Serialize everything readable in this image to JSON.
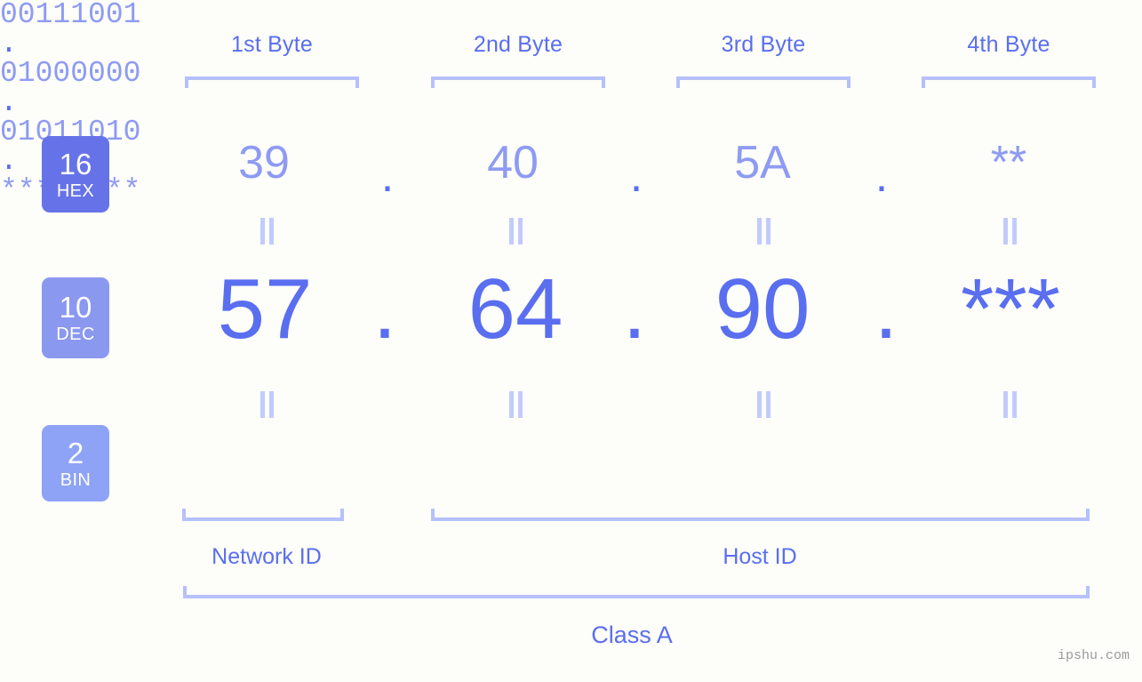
{
  "background_color": "#fdfdfa",
  "accent_color": "#5a6ef0",
  "accent_light_color": "#8e9bf2",
  "bracket_color": "#b6c0fb",
  "byte_headers": [
    {
      "label": "1st Byte"
    },
    {
      "label": "2nd Byte"
    },
    {
      "label": "3rd Byte"
    },
    {
      "label": "4th Byte"
    }
  ],
  "rows": [
    {
      "base_number": "16",
      "base_abbr": "HEX",
      "badge_color": "#6673e8",
      "values": [
        "39",
        "40",
        "5A",
        "**"
      ],
      "separator": "."
    },
    {
      "base_number": "10",
      "base_abbr": "DEC",
      "badge_color": "#8b98f0",
      "values": [
        "57",
        "64",
        "90",
        "***"
      ],
      "separator": "."
    },
    {
      "base_number": "2",
      "base_abbr": "BIN",
      "badge_color": "#8ea3f5",
      "values": [
        "00111001",
        "01000000",
        "01011010",
        "********"
      ],
      "separator": "."
    }
  ],
  "equals_marker": "=",
  "sections": [
    {
      "label": "Network ID"
    },
    {
      "label": "Host ID"
    }
  ],
  "class_label": "Class A",
  "watermark": "ipshu.com"
}
